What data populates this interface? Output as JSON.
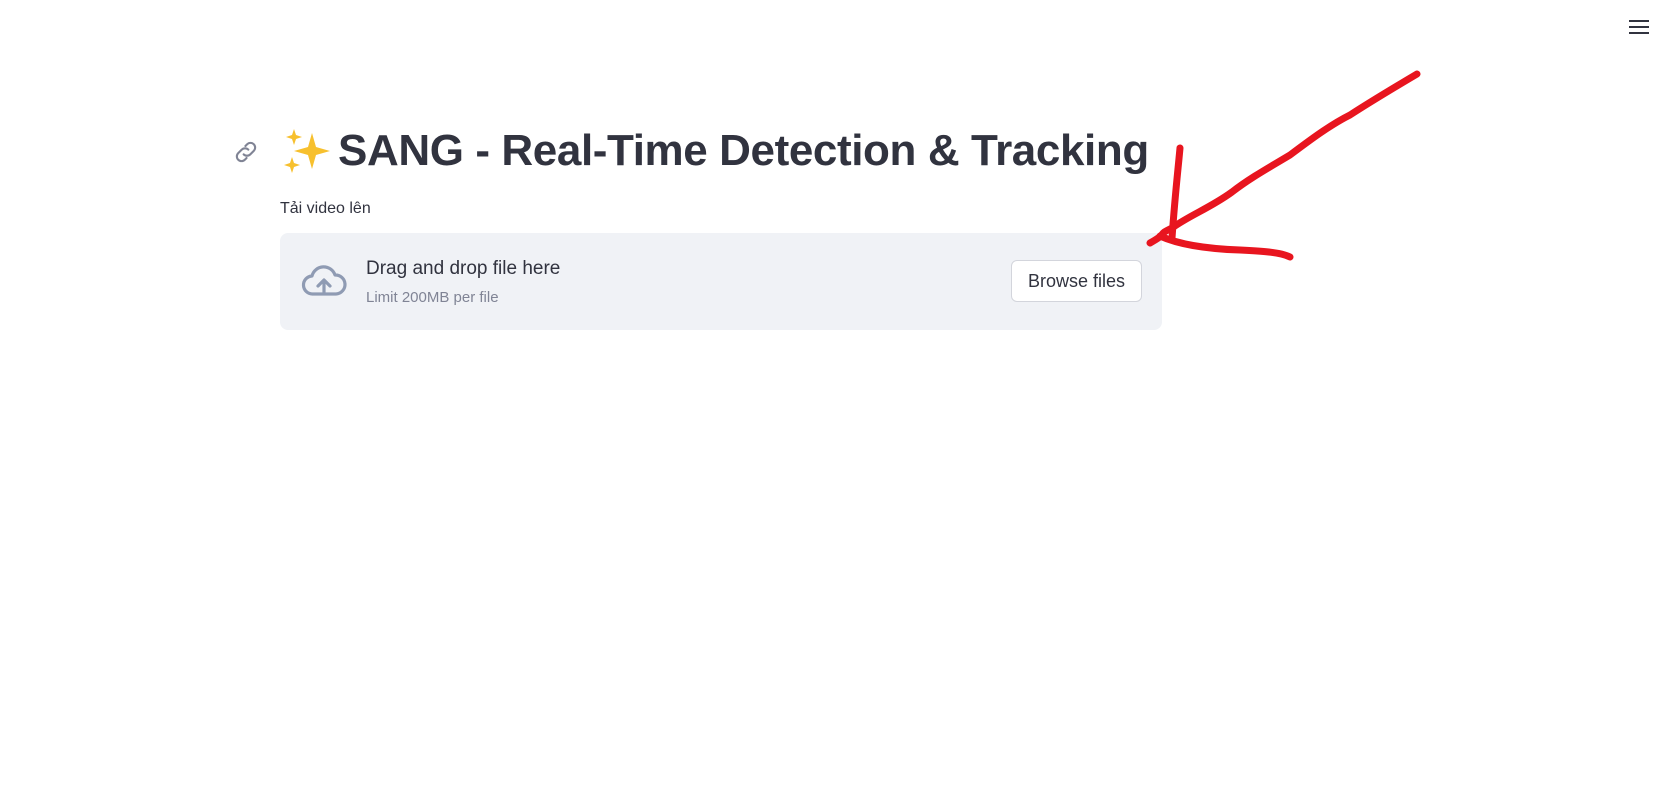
{
  "header": {
    "menu_icon": "hamburger-menu-icon"
  },
  "main": {
    "title_icon": "sparkles-emoji",
    "title": "SANG - Real-Time Detection & Tracking",
    "anchor_icon": "link-icon"
  },
  "uploader": {
    "label": "Tải video lên",
    "drop_text": "Drag and drop file here",
    "limit_text": "Limit 200MB per file",
    "browse_label": "Browse files",
    "icon": "cloud-upload-icon"
  },
  "annotation": {
    "type": "hand-drawn-arrow",
    "color": "#e8151f"
  },
  "colors": {
    "text": "#31333f",
    "muted": "#808495",
    "dropzone_bg": "#f0f2f6",
    "icon": "#8f9bb3",
    "sparkle": "#f7c02e"
  }
}
